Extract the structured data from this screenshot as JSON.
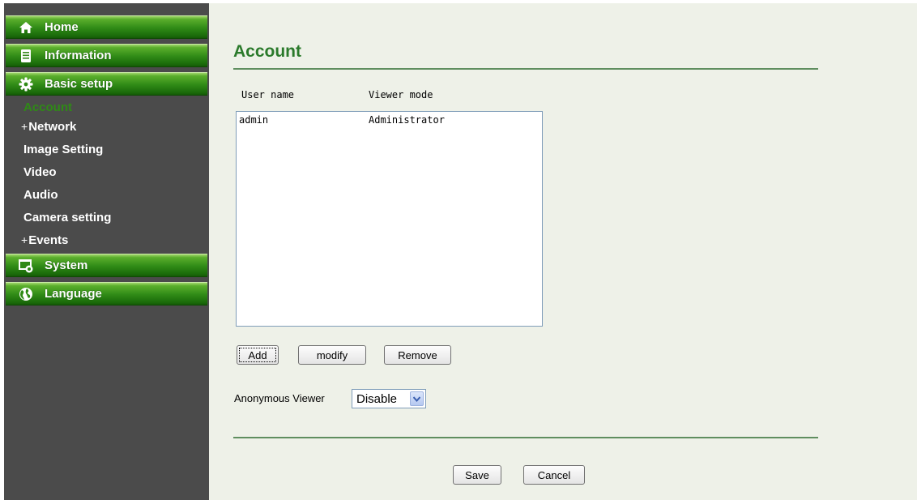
{
  "sidebar": {
    "top_items": [
      {
        "label": "Home",
        "icon": "home-icon"
      },
      {
        "label": "Information",
        "icon": "document-icon"
      },
      {
        "label": "Basic setup",
        "icon": "gear-icon"
      }
    ],
    "sub_items": [
      {
        "label": "Account",
        "active": true
      },
      {
        "label": "Network",
        "expandable": true,
        "prefix": "+"
      },
      {
        "label": "Image Setting"
      },
      {
        "label": "Video"
      },
      {
        "label": "Audio"
      },
      {
        "label": "Camera setting"
      },
      {
        "label": "Events",
        "expandable": true,
        "prefix": "+"
      }
    ],
    "bottom_items": [
      {
        "label": "System",
        "icon": "system-settings-icon"
      },
      {
        "label": "Language",
        "icon": "globe-icon"
      }
    ],
    "colors": {
      "background": "#4b4b4b",
      "button_green": "#2f8a16",
      "active_sub": "#2f8a16"
    }
  },
  "main": {
    "title": "Account",
    "columns": {
      "user_name": "User name",
      "viewer_mode": "Viewer mode"
    },
    "users": [
      {
        "name": "admin",
        "mode": "Administrator"
      }
    ],
    "buttons": {
      "add": "Add",
      "modify": "modify",
      "remove": "Remove"
    },
    "anonymous_viewer": {
      "label": "Anonymous Viewer",
      "value": "Disable"
    },
    "footer": {
      "save": "Save",
      "cancel": "Cancel"
    },
    "colors": {
      "background": "#eef1e8",
      "title": "#2b7a2b",
      "rule": "#5f8e5f"
    }
  }
}
